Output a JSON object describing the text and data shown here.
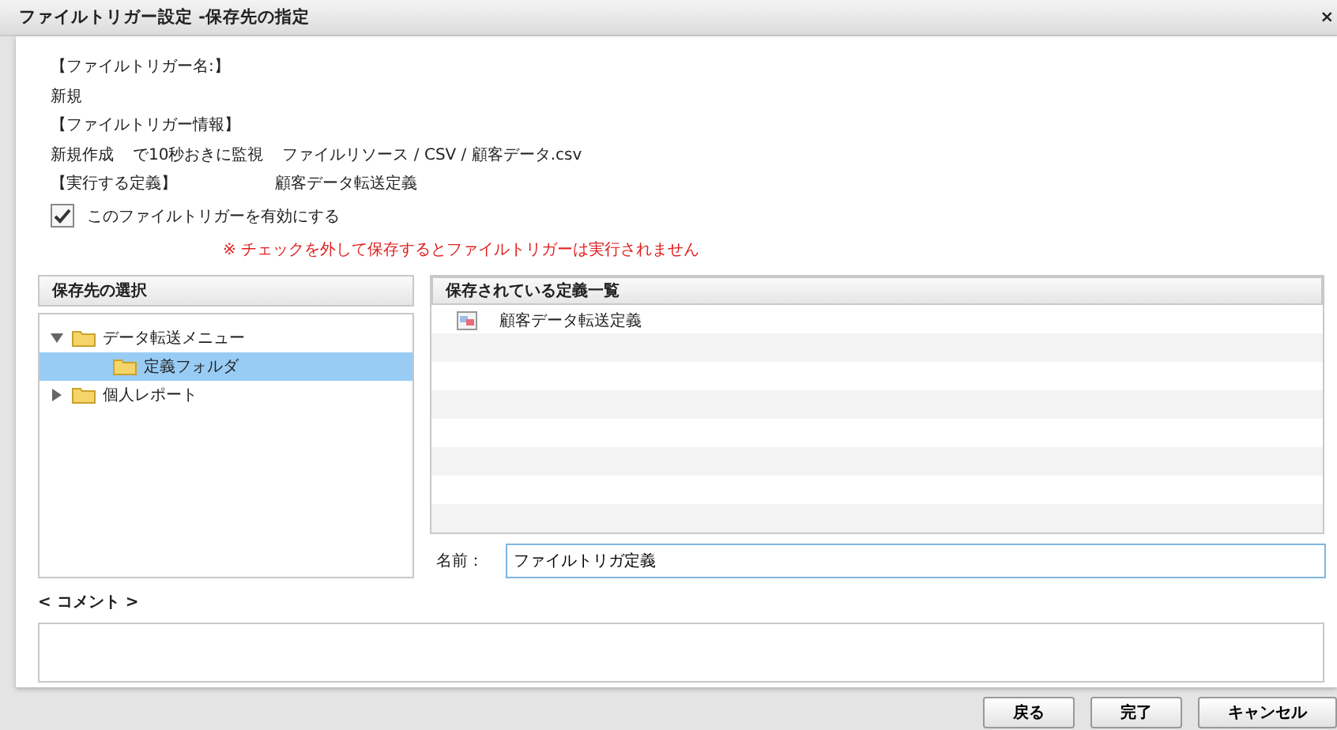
{
  "window": {
    "title": "ファイルトリガー設定 -保存先の指定",
    "close": "×"
  },
  "info": {
    "name_label": "【ファイルトリガー名:】",
    "name_value": "新規",
    "info_label": "【ファイルトリガー情報】",
    "info_parts": [
      "新規作成",
      "で10秒おきに監視",
      "ファイルリソース / CSV / 顧客データ.csv"
    ],
    "def_label": "【実行する定義】",
    "def_value": "顧客データ転送定義"
  },
  "enable": {
    "label": "このファイルトリガーを有効にする",
    "checked": true,
    "warning": "※ チェックを外して保存するとファイルトリガーは実行されません"
  },
  "tree": {
    "title": "保存先の選択",
    "items": [
      {
        "label": "データ転送メニュー",
        "expanded": true,
        "selected": false,
        "children": [
          {
            "label": "定義フォルダ",
            "selected": true
          }
        ]
      },
      {
        "label": "個人レポート",
        "expanded": false,
        "selected": false
      }
    ]
  },
  "list": {
    "title": "保存されている定義一覧",
    "rows": [
      "顧客データ転送定義"
    ]
  },
  "name_field": {
    "label": "名前：",
    "value": "ファイルトリガ定義"
  },
  "comment": {
    "label": "< コメント >"
  },
  "buttons": [
    "戻る",
    "完了",
    "キャンセル"
  ]
}
